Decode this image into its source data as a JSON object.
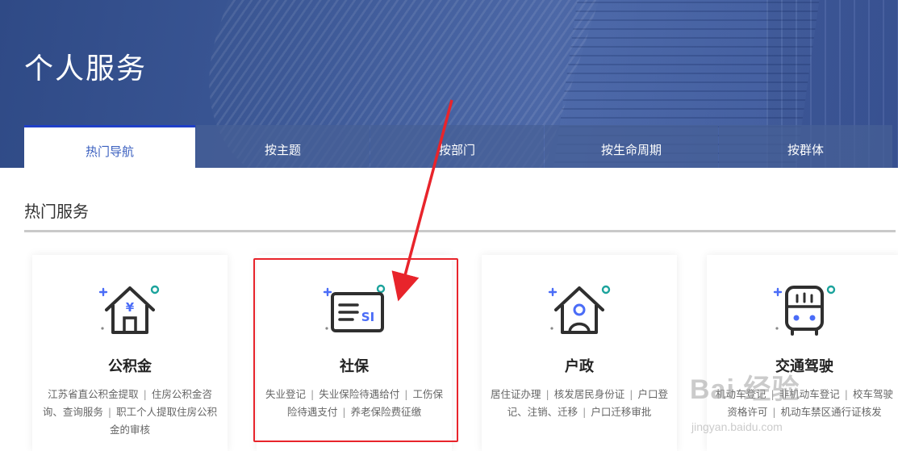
{
  "banner": {
    "title": "个人服务"
  },
  "tabs": [
    {
      "label": "热门导航",
      "active": true
    },
    {
      "label": "按主题"
    },
    {
      "label": "按部门"
    },
    {
      "label": "按生命周期"
    },
    {
      "label": "按群体"
    }
  ],
  "section": {
    "title": "热门服务"
  },
  "cards": [
    {
      "title": "公积金",
      "icon": "house-yen-icon",
      "links": [
        "江苏省直公积金提取",
        "住房公积金咨询、查询服务",
        "职工个人提取住房公积金的审核"
      ]
    },
    {
      "title": "社保",
      "icon": "social-insurance-card-icon",
      "links": [
        "失业登记",
        "失业保险待遇给付",
        "工伤保险待遇支付",
        "养老保险费征缴"
      ]
    },
    {
      "title": "户政",
      "icon": "house-person-icon",
      "links": [
        "居住证办理",
        "核发居民身份证",
        "户口登记、注销、迁移",
        "户口迁移审批"
      ]
    },
    {
      "title": "交通驾驶",
      "icon": "bus-icon",
      "links": [
        "机动车登记",
        "非机动车登记",
        "校车驾驶资格许可",
        "机动车禁区通行证核发"
      ]
    }
  ],
  "annotation": {
    "color": "#e8242b"
  },
  "watermark": {
    "main": "Bai 经验",
    "sub": "jingyan.baidu.com"
  },
  "colors": {
    "accent": "#1f3fc8",
    "icon_blue": "#4a6cf7",
    "icon_teal": "#1ba39c"
  }
}
